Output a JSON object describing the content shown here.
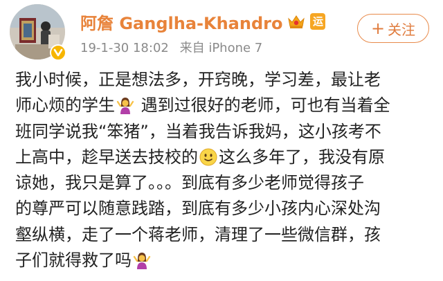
{
  "user": {
    "name": "阿詹 Ganglha-Khandro",
    "yun_badge": "运"
  },
  "post": {
    "time": "19-1-30 18:02",
    "source": "来自 iPhone 7",
    "lines": [
      "我小时候，正是想法多，开窍晚，学习差，最让老",
      "师心烦的学生",
      " 遇到过很好的老师，可也有当着全",
      "班同学说我“笨猪”，当着我告诉我妈，这小孩考不",
      "上高中，趁早送去技校的",
      "这么多年了，我没有原",
      "谅她，我只是算了。。。到底有多少老师觉得孩子",
      "的尊严可以随意践踏，到底有多少小孩内心深处沟",
      "壑纵横，走了一个蒋老师，清理了一些微信群，孩",
      "子们就得救了吗"
    ]
  },
  "actions": {
    "follow_label": "关注"
  },
  "icons": {
    "verified": "verified-badge-icon",
    "member": "vip-crown-icon",
    "shrug": "person-shrugging-emoji",
    "smile": "slightly-smiling-emoji"
  },
  "colors": {
    "username": "#e8833a",
    "accent": "#e07c3e",
    "meta": "#8a8a8a",
    "text": "#222222"
  }
}
